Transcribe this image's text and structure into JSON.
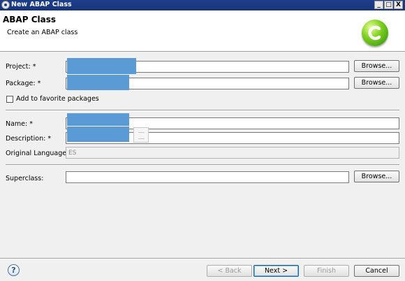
{
  "window": {
    "title": "New ABAP Class",
    "min_glyph": "_",
    "max_glyph": "□",
    "close_glyph": "X"
  },
  "header": {
    "title": "ABAP Class",
    "subtitle": "Create an ABAP class"
  },
  "form": {
    "project_label": "Project: *",
    "package_label": "Package: *",
    "favorite_label": "Add to favorite packages",
    "name_label": "Name: *",
    "description_label": "Description: *",
    "language_label": "Original Language:",
    "language_value": "ES",
    "superclass_label": "Superclass:",
    "browse_label": "Browse..."
  },
  "footer": {
    "help_glyph": "?",
    "back_label": "< Back",
    "next_label": "Next >",
    "finish_label": "Finish",
    "cancel_label": "Cancel"
  }
}
